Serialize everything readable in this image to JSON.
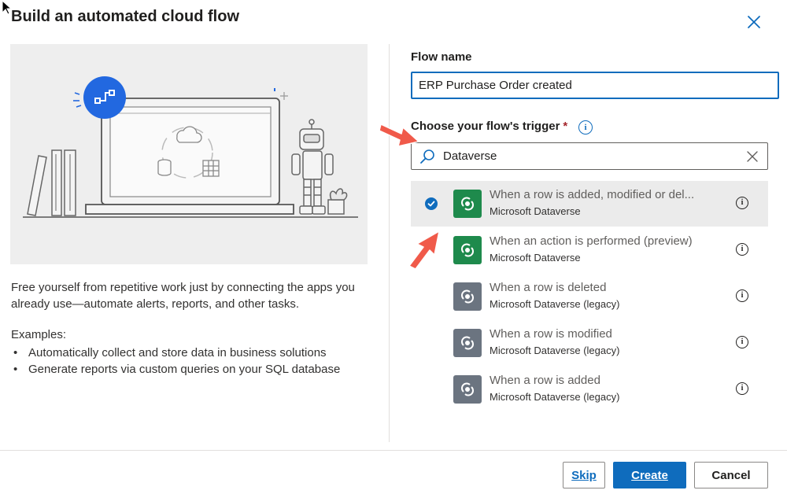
{
  "dialog": {
    "title": "Build an automated cloud flow"
  },
  "left": {
    "description": "Free yourself from repetitive work just by connecting the apps you already use—automate alerts, reports, and other tasks.",
    "examples_label": "Examples:",
    "examples": [
      "Automatically collect and store data in business solutions",
      "Generate reports via custom queries on your SQL database"
    ]
  },
  "form": {
    "flow_name_label": "Flow name",
    "flow_name_value": "ERP Purchase Order created",
    "trigger_label": "Choose your flow's trigger",
    "required_mark": "*",
    "search_value": "Dataverse"
  },
  "triggers": [
    {
      "title": "When a row is added, modified or del...",
      "subtitle": "Microsoft Dataverse",
      "selected": true,
      "tile_color": "#1e8a4c"
    },
    {
      "title": "When an action is performed (preview)",
      "subtitle": "Microsoft Dataverse",
      "selected": false,
      "tile_color": "#1e8a4c"
    },
    {
      "title": "When a row is deleted",
      "subtitle": "Microsoft Dataverse (legacy)",
      "selected": false,
      "tile_color": "#6b7480"
    },
    {
      "title": "When a row is modified",
      "subtitle": "Microsoft Dataverse (legacy)",
      "selected": false,
      "tile_color": "#6b7480"
    },
    {
      "title": "When a row is added",
      "subtitle": "Microsoft Dataverse (legacy)",
      "selected": false,
      "tile_color": "#6b7480"
    }
  ],
  "buttons": {
    "skip": "Skip",
    "create": "Create",
    "cancel": "Cancel"
  },
  "colors": {
    "accent": "#0f6cbd",
    "annotation_arrow": "#f05a4a"
  }
}
